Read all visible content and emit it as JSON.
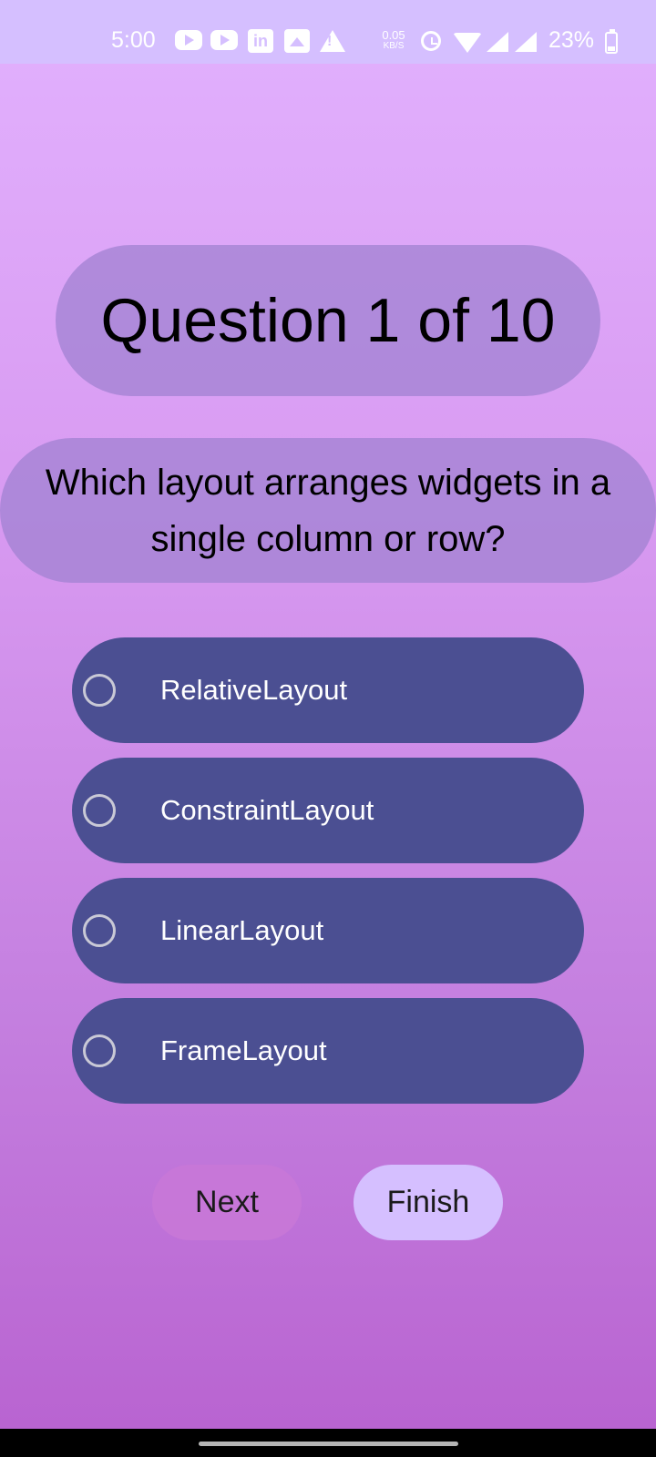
{
  "status_bar": {
    "time": "5:00",
    "net_speed_value": "0.05",
    "net_speed_unit": "KB/S",
    "battery_percent": "23%",
    "icons": [
      "youtube-icon",
      "youtube-icon",
      "linkedin-icon",
      "gallery-icon",
      "warning-icon",
      "alarm-icon",
      "wifi-icon",
      "signal-icon",
      "signal-icon",
      "battery-icon"
    ],
    "linkedin_letters": "in"
  },
  "quiz": {
    "counter": "Question 1 of 10",
    "question": "Which layout arranges widgets in a single column or row?",
    "options": [
      {
        "label": "RelativeLayout",
        "selected": false
      },
      {
        "label": "ConstraintLayout",
        "selected": false
      },
      {
        "label": "LinearLayout",
        "selected": false
      },
      {
        "label": "FrameLayout",
        "selected": false
      }
    ]
  },
  "buttons": {
    "next_label": "Next",
    "finish_label": "Finish"
  },
  "colors": {
    "status_bar_bg": "#d5bfff",
    "option_bg": "#4b4f92",
    "finish_bg": "#d5bfff"
  }
}
